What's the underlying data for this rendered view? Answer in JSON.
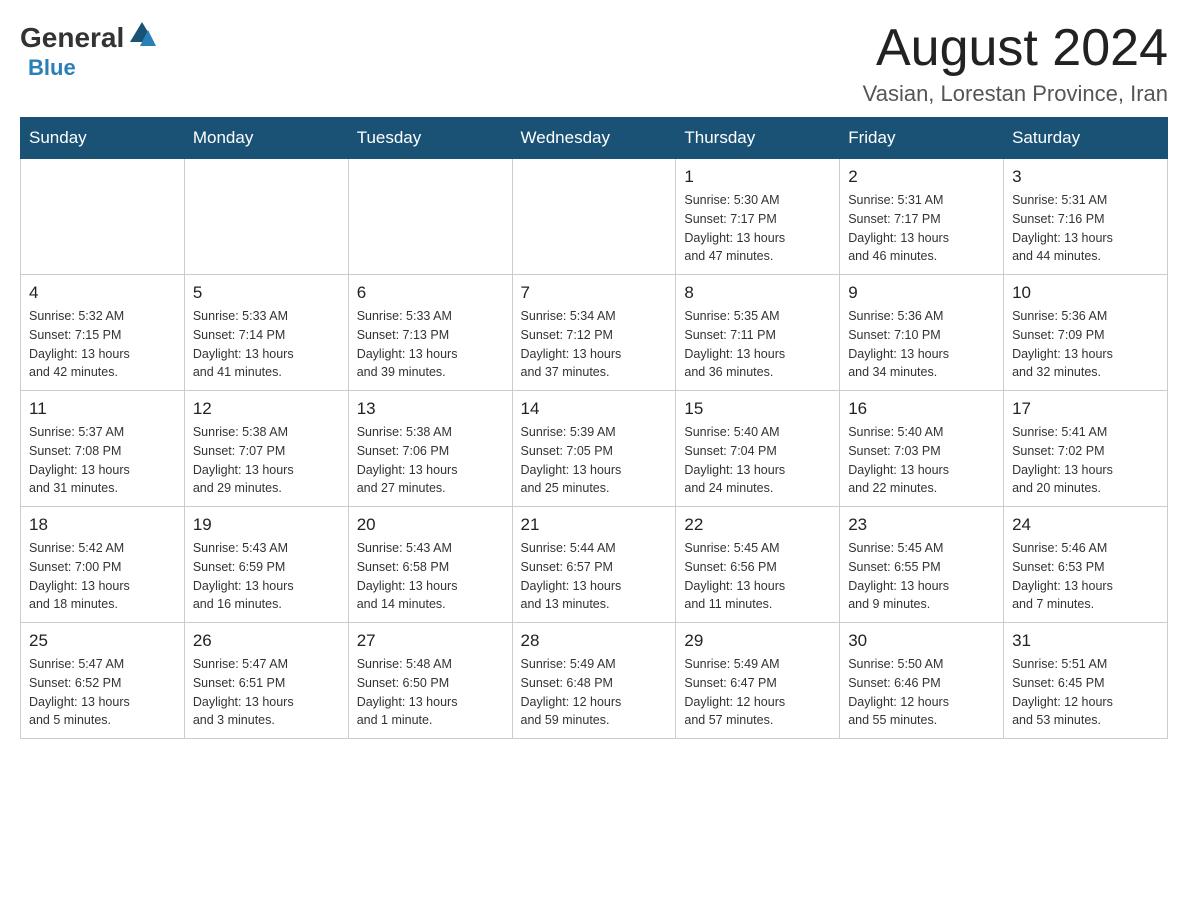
{
  "header": {
    "logo_general": "General",
    "logo_blue": "Blue",
    "month_title": "August 2024",
    "location": "Vasian, Lorestan Province, Iran"
  },
  "days_of_week": [
    "Sunday",
    "Monday",
    "Tuesday",
    "Wednesday",
    "Thursday",
    "Friday",
    "Saturday"
  ],
  "weeks": [
    [
      {
        "day": "",
        "info": ""
      },
      {
        "day": "",
        "info": ""
      },
      {
        "day": "",
        "info": ""
      },
      {
        "day": "",
        "info": ""
      },
      {
        "day": "1",
        "info": "Sunrise: 5:30 AM\nSunset: 7:17 PM\nDaylight: 13 hours\nand 47 minutes."
      },
      {
        "day": "2",
        "info": "Sunrise: 5:31 AM\nSunset: 7:17 PM\nDaylight: 13 hours\nand 46 minutes."
      },
      {
        "day": "3",
        "info": "Sunrise: 5:31 AM\nSunset: 7:16 PM\nDaylight: 13 hours\nand 44 minutes."
      }
    ],
    [
      {
        "day": "4",
        "info": "Sunrise: 5:32 AM\nSunset: 7:15 PM\nDaylight: 13 hours\nand 42 minutes."
      },
      {
        "day": "5",
        "info": "Sunrise: 5:33 AM\nSunset: 7:14 PM\nDaylight: 13 hours\nand 41 minutes."
      },
      {
        "day": "6",
        "info": "Sunrise: 5:33 AM\nSunset: 7:13 PM\nDaylight: 13 hours\nand 39 minutes."
      },
      {
        "day": "7",
        "info": "Sunrise: 5:34 AM\nSunset: 7:12 PM\nDaylight: 13 hours\nand 37 minutes."
      },
      {
        "day": "8",
        "info": "Sunrise: 5:35 AM\nSunset: 7:11 PM\nDaylight: 13 hours\nand 36 minutes."
      },
      {
        "day": "9",
        "info": "Sunrise: 5:36 AM\nSunset: 7:10 PM\nDaylight: 13 hours\nand 34 minutes."
      },
      {
        "day": "10",
        "info": "Sunrise: 5:36 AM\nSunset: 7:09 PM\nDaylight: 13 hours\nand 32 minutes."
      }
    ],
    [
      {
        "day": "11",
        "info": "Sunrise: 5:37 AM\nSunset: 7:08 PM\nDaylight: 13 hours\nand 31 minutes."
      },
      {
        "day": "12",
        "info": "Sunrise: 5:38 AM\nSunset: 7:07 PM\nDaylight: 13 hours\nand 29 minutes."
      },
      {
        "day": "13",
        "info": "Sunrise: 5:38 AM\nSunset: 7:06 PM\nDaylight: 13 hours\nand 27 minutes."
      },
      {
        "day": "14",
        "info": "Sunrise: 5:39 AM\nSunset: 7:05 PM\nDaylight: 13 hours\nand 25 minutes."
      },
      {
        "day": "15",
        "info": "Sunrise: 5:40 AM\nSunset: 7:04 PM\nDaylight: 13 hours\nand 24 minutes."
      },
      {
        "day": "16",
        "info": "Sunrise: 5:40 AM\nSunset: 7:03 PM\nDaylight: 13 hours\nand 22 minutes."
      },
      {
        "day": "17",
        "info": "Sunrise: 5:41 AM\nSunset: 7:02 PM\nDaylight: 13 hours\nand 20 minutes."
      }
    ],
    [
      {
        "day": "18",
        "info": "Sunrise: 5:42 AM\nSunset: 7:00 PM\nDaylight: 13 hours\nand 18 minutes."
      },
      {
        "day": "19",
        "info": "Sunrise: 5:43 AM\nSunset: 6:59 PM\nDaylight: 13 hours\nand 16 minutes."
      },
      {
        "day": "20",
        "info": "Sunrise: 5:43 AM\nSunset: 6:58 PM\nDaylight: 13 hours\nand 14 minutes."
      },
      {
        "day": "21",
        "info": "Sunrise: 5:44 AM\nSunset: 6:57 PM\nDaylight: 13 hours\nand 13 minutes."
      },
      {
        "day": "22",
        "info": "Sunrise: 5:45 AM\nSunset: 6:56 PM\nDaylight: 13 hours\nand 11 minutes."
      },
      {
        "day": "23",
        "info": "Sunrise: 5:45 AM\nSunset: 6:55 PM\nDaylight: 13 hours\nand 9 minutes."
      },
      {
        "day": "24",
        "info": "Sunrise: 5:46 AM\nSunset: 6:53 PM\nDaylight: 13 hours\nand 7 minutes."
      }
    ],
    [
      {
        "day": "25",
        "info": "Sunrise: 5:47 AM\nSunset: 6:52 PM\nDaylight: 13 hours\nand 5 minutes."
      },
      {
        "day": "26",
        "info": "Sunrise: 5:47 AM\nSunset: 6:51 PM\nDaylight: 13 hours\nand 3 minutes."
      },
      {
        "day": "27",
        "info": "Sunrise: 5:48 AM\nSunset: 6:50 PM\nDaylight: 13 hours\nand 1 minute."
      },
      {
        "day": "28",
        "info": "Sunrise: 5:49 AM\nSunset: 6:48 PM\nDaylight: 12 hours\nand 59 minutes."
      },
      {
        "day": "29",
        "info": "Sunrise: 5:49 AM\nSunset: 6:47 PM\nDaylight: 12 hours\nand 57 minutes."
      },
      {
        "day": "30",
        "info": "Sunrise: 5:50 AM\nSunset: 6:46 PM\nDaylight: 12 hours\nand 55 minutes."
      },
      {
        "day": "31",
        "info": "Sunrise: 5:51 AM\nSunset: 6:45 PM\nDaylight: 12 hours\nand 53 minutes."
      }
    ]
  ]
}
